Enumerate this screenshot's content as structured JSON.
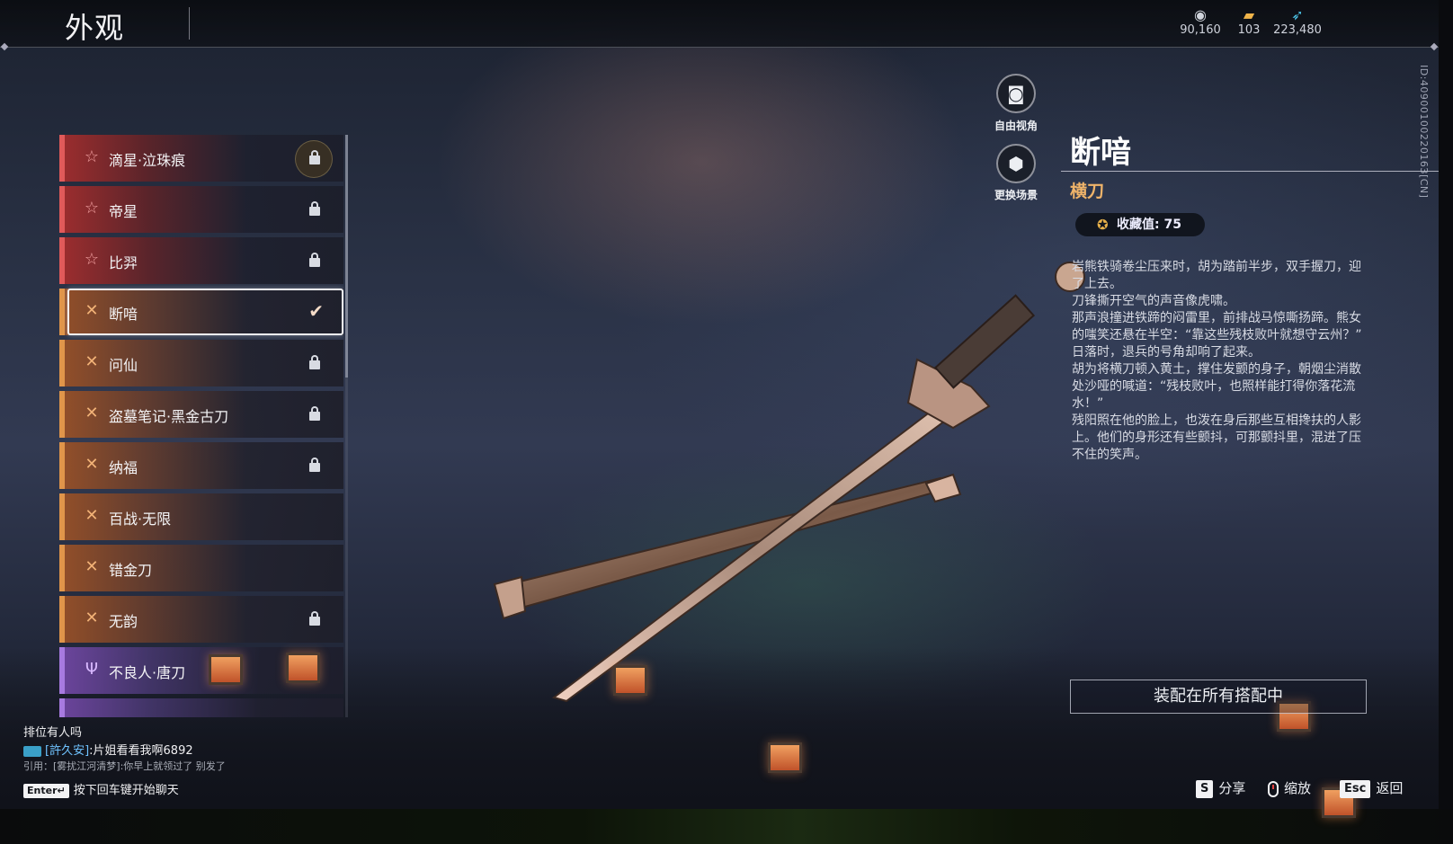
{
  "header": {
    "title": "外观",
    "currencies": [
      {
        "icon": "eye-coin-icon",
        "value": "90,160"
      },
      {
        "icon": "gold-ticket-icon",
        "value": "103"
      },
      {
        "icon": "blue-feather-icon",
        "value": "223,480"
      }
    ]
  },
  "skin_list": {
    "items": [
      {
        "label": "滴星·泣珠痕",
        "rarity": "red",
        "icon": "star-icon",
        "locked": true
      },
      {
        "label": "帝星",
        "rarity": "red",
        "icon": "star-icon",
        "locked": true
      },
      {
        "label": "比羿",
        "rarity": "red",
        "icon": "star-icon",
        "locked": true
      },
      {
        "label": "断喑",
        "rarity": "orange",
        "icon": "cross-blades-icon",
        "selected": true,
        "equipped": true
      },
      {
        "label": "问仙",
        "rarity": "orange",
        "icon": "cross-blades-icon",
        "locked": true
      },
      {
        "label": "盗墓笔记·黑金古刀",
        "rarity": "orange",
        "icon": "cross-blades-icon",
        "locked": true
      },
      {
        "label": "纳福",
        "rarity": "orange",
        "icon": "cross-blades-icon",
        "locked": true
      },
      {
        "label": "百战·无限",
        "rarity": "orange",
        "icon": "cross-blades-icon",
        "locked": false
      },
      {
        "label": "错金刀",
        "rarity": "orange",
        "icon": "cross-blades-icon",
        "locked": false
      },
      {
        "label": "无韵",
        "rarity": "orange",
        "icon": "cross-blades-icon",
        "locked": true
      },
      {
        "label": "不良人·唐刀",
        "rarity": "purple",
        "icon": "trident-icon",
        "locked": false
      }
    ]
  },
  "camera_controls": {
    "free_view": "自由视角",
    "change_scene": "更换场景"
  },
  "detail": {
    "name": "断喑",
    "type": "横刀",
    "collection_label": "收藏值: 75",
    "description": "岩熊铁骑卷尘压来时，胡为踏前半步，双手握刀，迎了上去。\n刀锋撕开空气的声音像虎啸。\n那声浪撞进铁蹄的闷雷里，前排战马惊嘶扬蹄。熊女的嗤笑还悬在半空：“靠这些残枝败叶就想守云州？”\n日落时，退兵的号角却响了起来。\n胡为将横刀顿入黄土，撑住发颤的身子，朝烟尘消散处沙哑的喊道：“残枝败叶，也照样能打得你落花流水！”\n残阳照在他的脸上，也泼在身后那些互相搀扶的人影上。他们的身形还有些颤抖，可那颤抖里，混进了压不住的笑声。",
    "equip_button": "装配在所有搭配中",
    "id_text": "ID:4090010022016З[CN]"
  },
  "chat": {
    "line1": "排位有人吗",
    "line2_name": "[許久安]",
    "line2_text": ":片姐看看我啊6892",
    "line3": "引用：[雾扰江河清梦]:你早上就领过了 别发了",
    "enter_key": "Enter↵",
    "prompt": "按下回车键开始聊天"
  },
  "hints": {
    "share_key": "S",
    "share": "分享",
    "zoom": "缩放",
    "back_key": "Esc",
    "back": "返回"
  }
}
